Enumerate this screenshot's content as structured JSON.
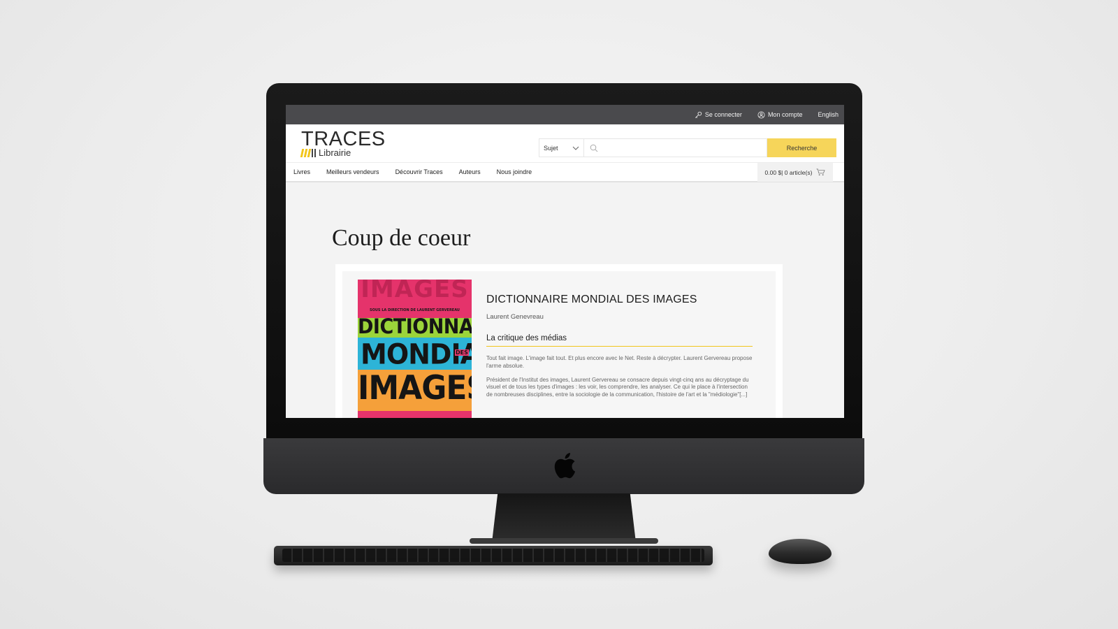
{
  "topbar": {
    "login": "Se connecter",
    "account": "Mon compte",
    "language": "English"
  },
  "brand": {
    "name": "TRACES",
    "sub": "Librairie",
    "bar_color": "#f2c51b"
  },
  "search": {
    "select_value": "Sujet",
    "placeholder": "",
    "button_label": "Recherche",
    "button_color": "#f6d55a"
  },
  "nav": {
    "items": [
      {
        "label": "Livres"
      },
      {
        "label": "Meilleurs vendeurs"
      },
      {
        "label": "Découvrir Traces"
      },
      {
        "label": "Auteurs"
      },
      {
        "label": "Nous joindre"
      }
    ],
    "cart": "0.00 $| 0 article(s)"
  },
  "main": {
    "title": "Coup de coeur",
    "book": {
      "cover": {
        "ghost": "IMAGES",
        "director": "SOUS LA DIRECTION DE LAURENT GERVEREAU",
        "line1": "DICTIONNAIRE",
        "line2": "MONDIAL",
        "small": "DES",
        "line3": "IMAGES"
      },
      "title": "DICTIONNAIRE MONDIAL DES IMAGES",
      "author": "Laurent Genevreau",
      "review_title": "La critique des médias",
      "paragraphs": [
        "Tout fait image. L'image fait tout. Et plus encore avec le Net. Reste à décrypter. Laurent Gervereau propose l'arme absolue.",
        "Président de l'Institut des images, Laurent Gervereau se consacre depuis vingt-cinq ans au décryptage du visuel et de tous les types d'images : les voir, les comprendre, les analyser. Ce qui le place à l'intersection de nombreuses disciplines, entre la sociologie de la communication, l'histoire de l'art et la \"médiologie\"[...]"
      ]
    }
  }
}
